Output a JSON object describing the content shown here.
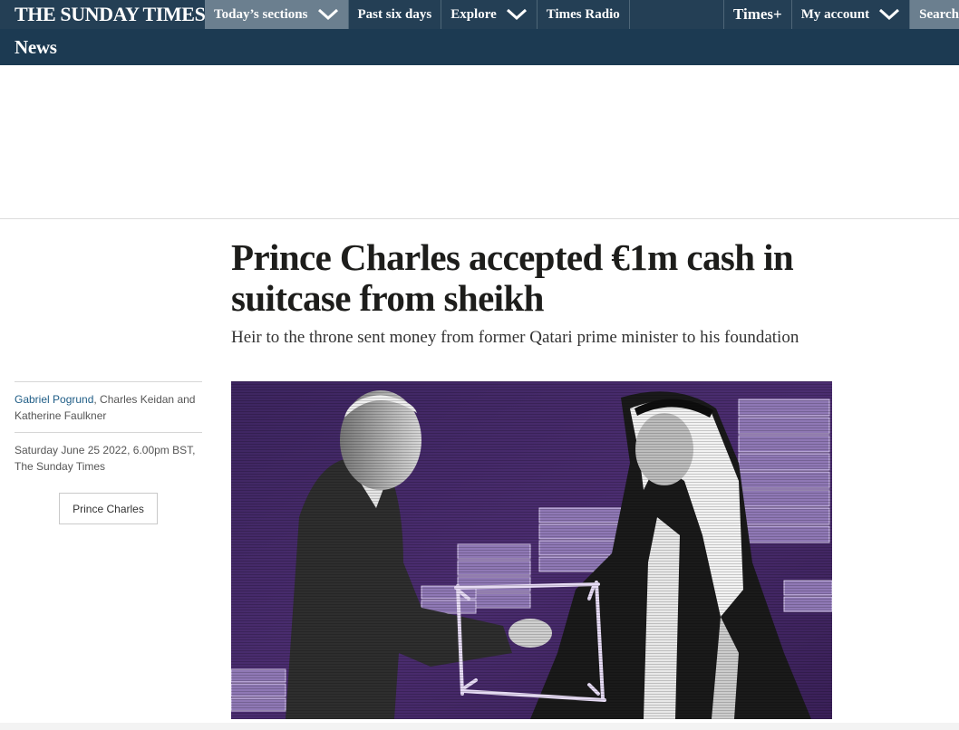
{
  "header": {
    "masthead": "THE SUNDAY TIMES",
    "nav": [
      {
        "label": "Today’s sections",
        "has_dropdown": true,
        "active": true
      },
      {
        "label": "Past six days",
        "has_dropdown": false
      },
      {
        "label": "Explore",
        "has_dropdown": true
      },
      {
        "label": "Times Radio",
        "has_dropdown": false
      }
    ],
    "right_nav": {
      "times_plus": "Times+",
      "my_account": "My account",
      "search": "Search"
    },
    "section": "News"
  },
  "article": {
    "headline": "Prince Charles accepted €1m cash in suitcase from sheikh",
    "standfirst": "Heir to the throne sent money from former Qatari prime minister to his foundation",
    "byline": {
      "lead_author": "Gabriel Pogrund",
      "co_authors": ", Charles Keidan and Katherine Faulkner"
    },
    "dateline": "Saturday June 25 2022, 6.00pm BST, The Sunday Times",
    "topic_tag": "Prince Charles"
  },
  "colors": {
    "nav_bg": "#243f55",
    "section_bar_bg": "#1c3a52",
    "nav_active_bg": "#6b7f8f",
    "link": "#1f5d86",
    "image_purple": "#4a2c6e"
  }
}
